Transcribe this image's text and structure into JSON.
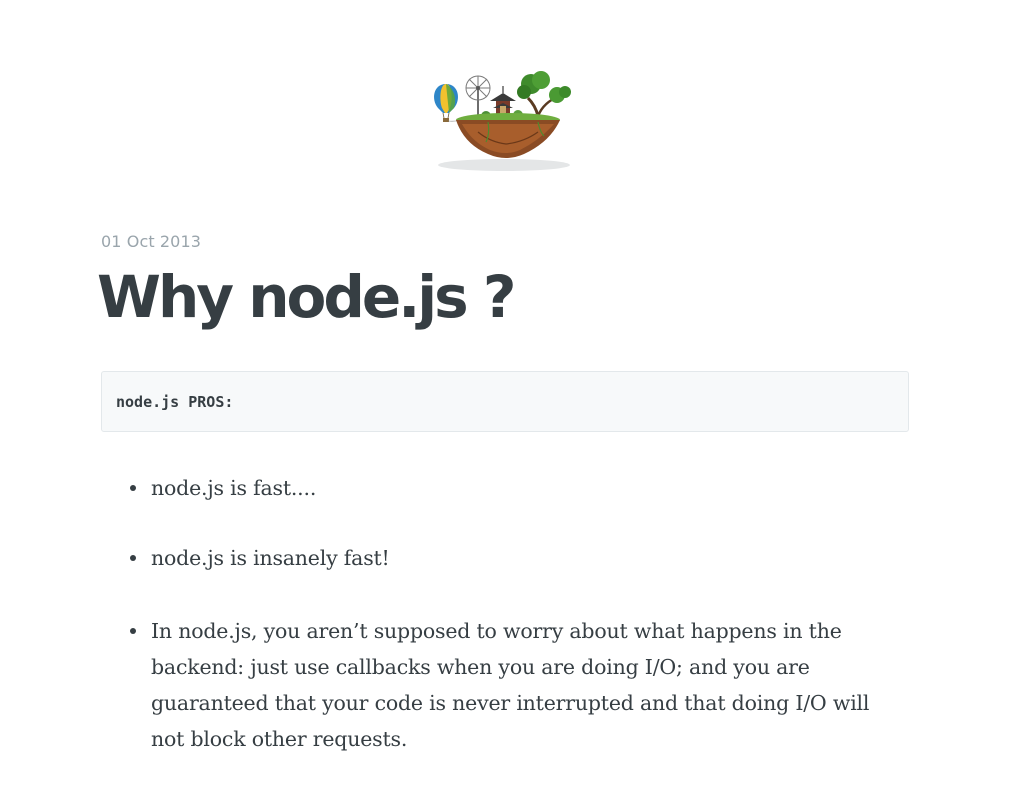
{
  "header": {
    "logo_icon": "floating-island-logo-icon"
  },
  "post": {
    "date": "01 Oct 2013",
    "title": "Why node.js ?",
    "code": "node.js PROS:",
    "bullets": [
      {
        "text": "node.js is fast...."
      },
      {
        "text": "node.js is insanely fast!"
      },
      {
        "text": "In node.js, you aren’t supposed to worry about what happens in the backend: just use callbacks when you are doing I/O; and you are guaranteed that your code is never interrupted and that doing I/O will not block other requests."
      }
    ]
  },
  "colors": {
    "text": "#363e43",
    "date": "#9aa5ac",
    "code_bg": "#f7f9fa",
    "code_border": "#e3e8eb"
  }
}
